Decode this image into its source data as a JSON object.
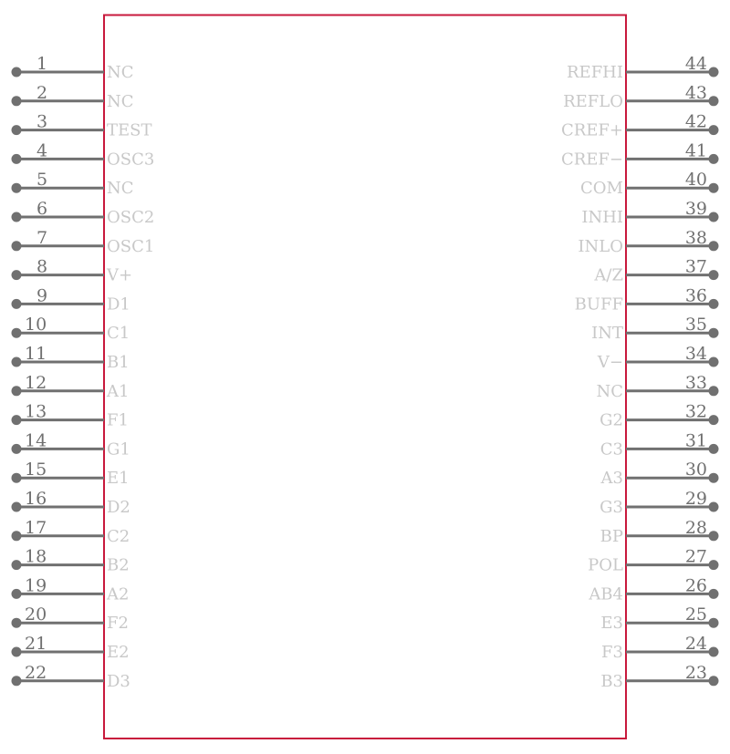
{
  "component": {
    "body_color": "#c8193c",
    "pin_color": "#707070",
    "label_color": "#c8c8c8",
    "left_pins": [
      {
        "number": "1",
        "name": "NC"
      },
      {
        "number": "2",
        "name": "NC"
      },
      {
        "number": "3",
        "name": "TEST"
      },
      {
        "number": "4",
        "name": "OSC3"
      },
      {
        "number": "5",
        "name": "NC"
      },
      {
        "number": "6",
        "name": "OSC2"
      },
      {
        "number": "7",
        "name": "OSC1"
      },
      {
        "number": "8",
        "name": "V+"
      },
      {
        "number": "9",
        "name": "D1"
      },
      {
        "number": "10",
        "name": "C1"
      },
      {
        "number": "11",
        "name": "B1"
      },
      {
        "number": "12",
        "name": "A1"
      },
      {
        "number": "13",
        "name": "F1"
      },
      {
        "number": "14",
        "name": "G1"
      },
      {
        "number": "15",
        "name": "E1"
      },
      {
        "number": "16",
        "name": "D2"
      },
      {
        "number": "17",
        "name": "C2"
      },
      {
        "number": "18",
        "name": "B2"
      },
      {
        "number": "19",
        "name": "A2"
      },
      {
        "number": "20",
        "name": "F2"
      },
      {
        "number": "21",
        "name": "E2"
      },
      {
        "number": "22",
        "name": "D3"
      }
    ],
    "right_pins": [
      {
        "number": "44",
        "name": "REFHI"
      },
      {
        "number": "43",
        "name": "REFLO"
      },
      {
        "number": "42",
        "name": "CREF+"
      },
      {
        "number": "41",
        "name": "CREF−"
      },
      {
        "number": "40",
        "name": "COM"
      },
      {
        "number": "39",
        "name": "INHI"
      },
      {
        "number": "38",
        "name": "INLO"
      },
      {
        "number": "37",
        "name": "A/Z"
      },
      {
        "number": "36",
        "name": "BUFF"
      },
      {
        "number": "35",
        "name": "INT"
      },
      {
        "number": "34",
        "name": "V−"
      },
      {
        "number": "33",
        "name": "NC"
      },
      {
        "number": "32",
        "name": "G2"
      },
      {
        "number": "31",
        "name": "C3"
      },
      {
        "number": "30",
        "name": "A3"
      },
      {
        "number": "29",
        "name": "G3"
      },
      {
        "number": "28",
        "name": "BP"
      },
      {
        "number": "27",
        "name": "POL"
      },
      {
        "number": "26",
        "name": "AB4"
      },
      {
        "number": "25",
        "name": "E3"
      },
      {
        "number": "24",
        "name": "F3"
      },
      {
        "number": "23",
        "name": "B3"
      }
    ]
  }
}
